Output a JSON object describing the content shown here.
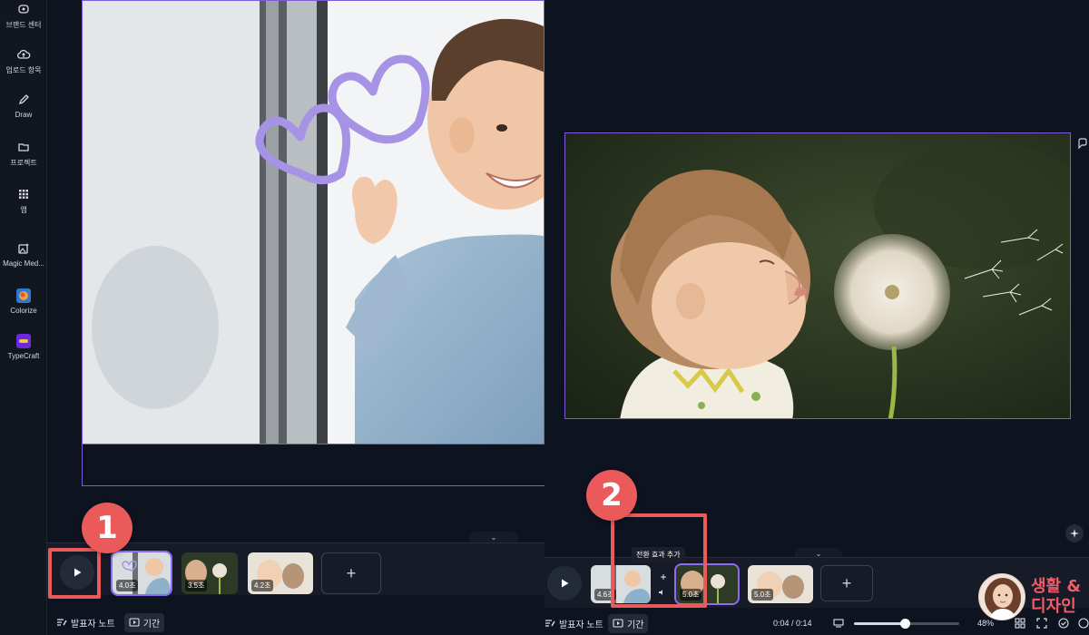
{
  "sidebar": {
    "items": [
      {
        "label": "브랜드 센터",
        "icon": "brand-center-icon"
      },
      {
        "label": "업로드 항목",
        "icon": "upload-cloud-icon"
      },
      {
        "label": "Draw",
        "icon": "pen-icon"
      },
      {
        "label": "프로젝트",
        "icon": "folder-icon"
      },
      {
        "label": "앱",
        "icon": "apps-grid-icon"
      },
      {
        "label": "Magic Med...",
        "icon": "magic-media-icon"
      },
      {
        "label": "Colorize",
        "icon": "colorize-app-icon"
      },
      {
        "label": "TypeCraft",
        "icon": "typecraft-app-icon"
      }
    ]
  },
  "left_panel": {
    "timeline": {
      "pages": [
        {
          "duration": "4.0초",
          "selected": true
        },
        {
          "duration": "3.5초",
          "selected": false
        },
        {
          "duration": "4.2초",
          "selected": false
        }
      ],
      "add_label": "+"
    },
    "bottom": {
      "notes_label": "발표자 노트",
      "duration_label": "기간"
    },
    "callout": "1"
  },
  "right_panel": {
    "timeline": {
      "pages": [
        {
          "duration": "4.6초",
          "selected": false
        },
        {
          "duration": "5.0초",
          "selected": true
        },
        {
          "duration": "5.0초",
          "selected": false
        }
      ],
      "add_label": "+",
      "add_transition_label": "+",
      "tooltip": "전환 효과 추가"
    },
    "bottom": {
      "notes_label": "발표자 노트",
      "duration_label": "기간",
      "time": "0:04 / 0:14",
      "zoom": "48%",
      "zoom_fraction": 0.48
    },
    "callout": "2"
  },
  "brand": {
    "line1": "생활 &",
    "line2": "디자인"
  },
  "colors": {
    "accent": "#8b6cf2",
    "callout": "#ea5a5a",
    "bg": "#0e1320"
  }
}
